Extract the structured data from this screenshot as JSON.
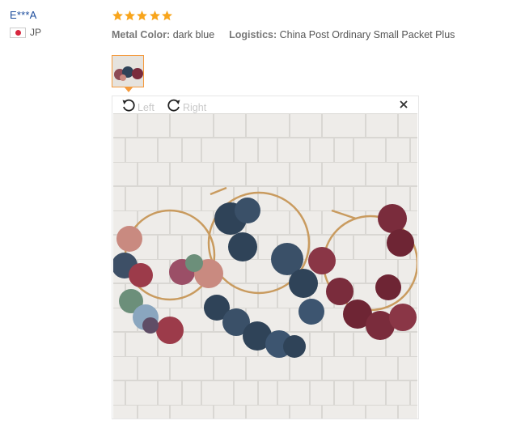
{
  "user": {
    "name": "E***A",
    "country": "JP"
  },
  "review": {
    "rating": 5,
    "attributes": [
      {
        "label": "Metal Color:",
        "value": "dark blue"
      },
      {
        "label": "Logistics:",
        "value": "China Post Ordinary Small Packet Plus"
      }
    ]
  },
  "viewer": {
    "rotate_left_label": "Left",
    "rotate_right_label": "Right"
  },
  "colors": {
    "star": "#f8a51c",
    "thumb_border": "#f49a3c",
    "username": "#1c4c9c",
    "flower_blue": "#2f4358",
    "flower_burgundy": "#7a2c3c",
    "flower_pink": "#c98a80",
    "hoop_gold": "#c99b5f"
  },
  "icons": {
    "rotate_left": "rotate-ccw-icon",
    "rotate_right": "rotate-cw-icon",
    "close": "close-icon",
    "star": "star-icon",
    "flag": "japan-flag-icon"
  }
}
